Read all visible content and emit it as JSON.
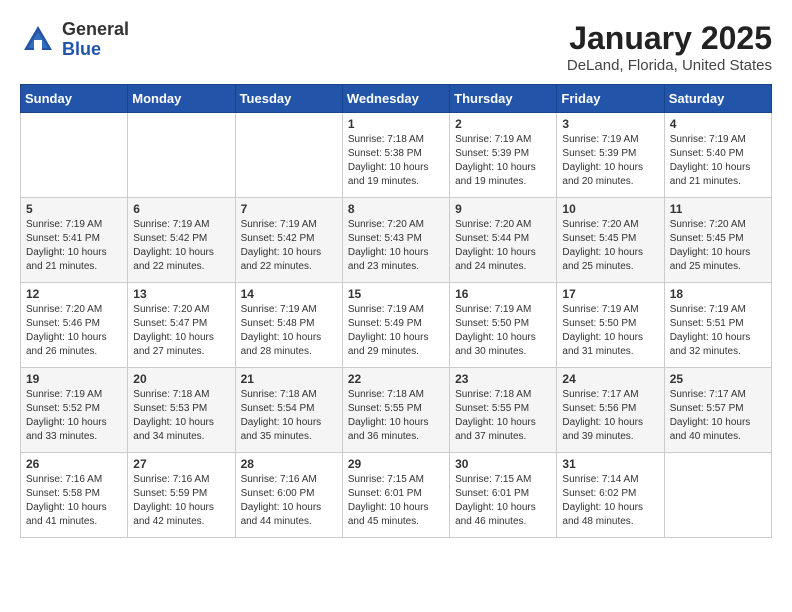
{
  "header": {
    "logo_general": "General",
    "logo_blue": "Blue",
    "month_title": "January 2025",
    "location": "DeLand, Florida, United States"
  },
  "days_of_week": [
    "Sunday",
    "Monday",
    "Tuesday",
    "Wednesday",
    "Thursday",
    "Friday",
    "Saturday"
  ],
  "weeks": [
    [
      {
        "day": "",
        "info": ""
      },
      {
        "day": "",
        "info": ""
      },
      {
        "day": "",
        "info": ""
      },
      {
        "day": "1",
        "info": "Sunrise: 7:18 AM\nSunset: 5:38 PM\nDaylight: 10 hours\nand 19 minutes."
      },
      {
        "day": "2",
        "info": "Sunrise: 7:19 AM\nSunset: 5:39 PM\nDaylight: 10 hours\nand 19 minutes."
      },
      {
        "day": "3",
        "info": "Sunrise: 7:19 AM\nSunset: 5:39 PM\nDaylight: 10 hours\nand 20 minutes."
      },
      {
        "day": "4",
        "info": "Sunrise: 7:19 AM\nSunset: 5:40 PM\nDaylight: 10 hours\nand 21 minutes."
      }
    ],
    [
      {
        "day": "5",
        "info": "Sunrise: 7:19 AM\nSunset: 5:41 PM\nDaylight: 10 hours\nand 21 minutes."
      },
      {
        "day": "6",
        "info": "Sunrise: 7:19 AM\nSunset: 5:42 PM\nDaylight: 10 hours\nand 22 minutes."
      },
      {
        "day": "7",
        "info": "Sunrise: 7:19 AM\nSunset: 5:42 PM\nDaylight: 10 hours\nand 22 minutes."
      },
      {
        "day": "8",
        "info": "Sunrise: 7:20 AM\nSunset: 5:43 PM\nDaylight: 10 hours\nand 23 minutes."
      },
      {
        "day": "9",
        "info": "Sunrise: 7:20 AM\nSunset: 5:44 PM\nDaylight: 10 hours\nand 24 minutes."
      },
      {
        "day": "10",
        "info": "Sunrise: 7:20 AM\nSunset: 5:45 PM\nDaylight: 10 hours\nand 25 minutes."
      },
      {
        "day": "11",
        "info": "Sunrise: 7:20 AM\nSunset: 5:45 PM\nDaylight: 10 hours\nand 25 minutes."
      }
    ],
    [
      {
        "day": "12",
        "info": "Sunrise: 7:20 AM\nSunset: 5:46 PM\nDaylight: 10 hours\nand 26 minutes."
      },
      {
        "day": "13",
        "info": "Sunrise: 7:20 AM\nSunset: 5:47 PM\nDaylight: 10 hours\nand 27 minutes."
      },
      {
        "day": "14",
        "info": "Sunrise: 7:19 AM\nSunset: 5:48 PM\nDaylight: 10 hours\nand 28 minutes."
      },
      {
        "day": "15",
        "info": "Sunrise: 7:19 AM\nSunset: 5:49 PM\nDaylight: 10 hours\nand 29 minutes."
      },
      {
        "day": "16",
        "info": "Sunrise: 7:19 AM\nSunset: 5:50 PM\nDaylight: 10 hours\nand 30 minutes."
      },
      {
        "day": "17",
        "info": "Sunrise: 7:19 AM\nSunset: 5:50 PM\nDaylight: 10 hours\nand 31 minutes."
      },
      {
        "day": "18",
        "info": "Sunrise: 7:19 AM\nSunset: 5:51 PM\nDaylight: 10 hours\nand 32 minutes."
      }
    ],
    [
      {
        "day": "19",
        "info": "Sunrise: 7:19 AM\nSunset: 5:52 PM\nDaylight: 10 hours\nand 33 minutes."
      },
      {
        "day": "20",
        "info": "Sunrise: 7:18 AM\nSunset: 5:53 PM\nDaylight: 10 hours\nand 34 minutes."
      },
      {
        "day": "21",
        "info": "Sunrise: 7:18 AM\nSunset: 5:54 PM\nDaylight: 10 hours\nand 35 minutes."
      },
      {
        "day": "22",
        "info": "Sunrise: 7:18 AM\nSunset: 5:55 PM\nDaylight: 10 hours\nand 36 minutes."
      },
      {
        "day": "23",
        "info": "Sunrise: 7:18 AM\nSunset: 5:55 PM\nDaylight: 10 hours\nand 37 minutes."
      },
      {
        "day": "24",
        "info": "Sunrise: 7:17 AM\nSunset: 5:56 PM\nDaylight: 10 hours\nand 39 minutes."
      },
      {
        "day": "25",
        "info": "Sunrise: 7:17 AM\nSunset: 5:57 PM\nDaylight: 10 hours\nand 40 minutes."
      }
    ],
    [
      {
        "day": "26",
        "info": "Sunrise: 7:16 AM\nSunset: 5:58 PM\nDaylight: 10 hours\nand 41 minutes."
      },
      {
        "day": "27",
        "info": "Sunrise: 7:16 AM\nSunset: 5:59 PM\nDaylight: 10 hours\nand 42 minutes."
      },
      {
        "day": "28",
        "info": "Sunrise: 7:16 AM\nSunset: 6:00 PM\nDaylight: 10 hours\nand 44 minutes."
      },
      {
        "day": "29",
        "info": "Sunrise: 7:15 AM\nSunset: 6:01 PM\nDaylight: 10 hours\nand 45 minutes."
      },
      {
        "day": "30",
        "info": "Sunrise: 7:15 AM\nSunset: 6:01 PM\nDaylight: 10 hours\nand 46 minutes."
      },
      {
        "day": "31",
        "info": "Sunrise: 7:14 AM\nSunset: 6:02 PM\nDaylight: 10 hours\nand 48 minutes."
      },
      {
        "day": "",
        "info": ""
      }
    ]
  ]
}
